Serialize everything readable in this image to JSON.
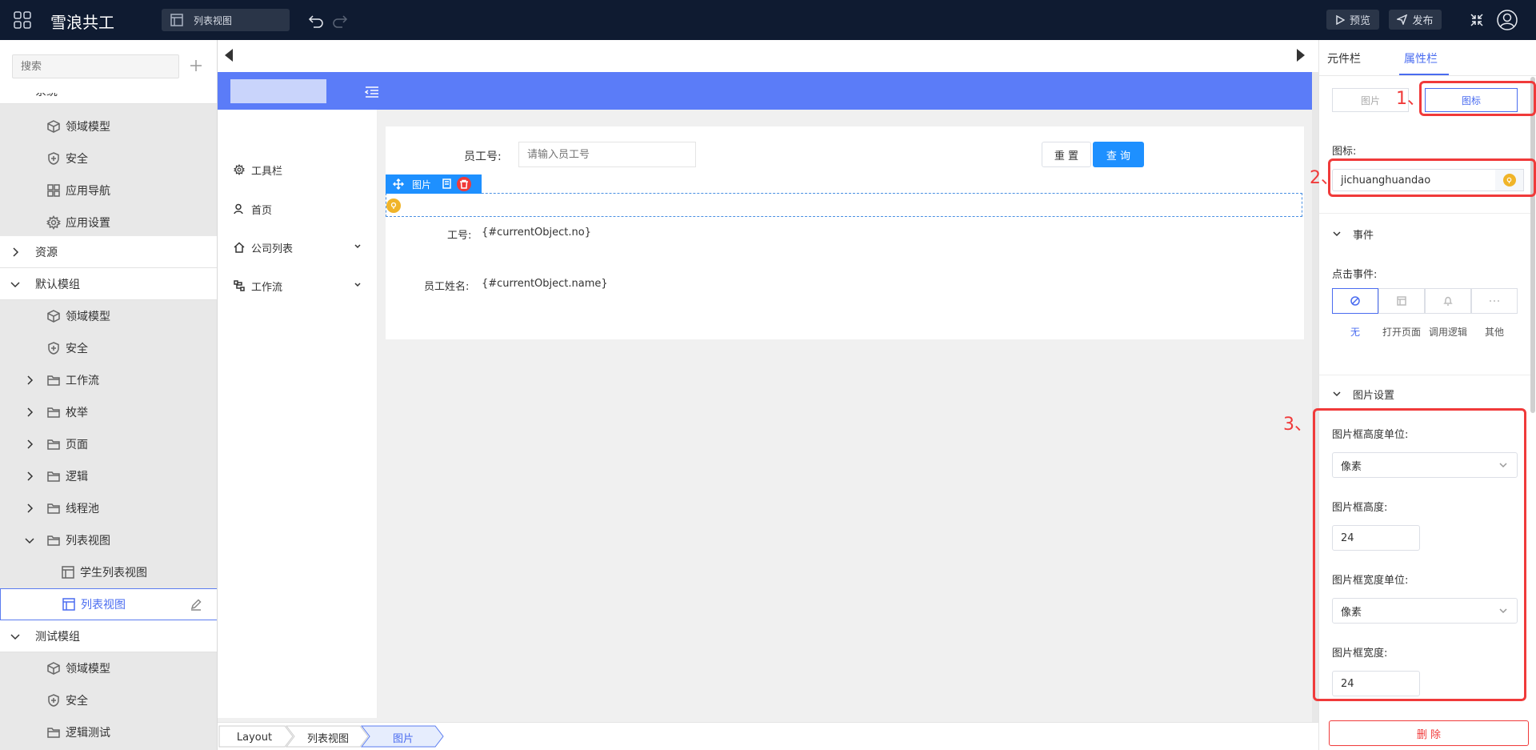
{
  "app": {
    "title": "雪浪共工"
  },
  "toolbar": {
    "view_tab": "列表视图",
    "preview": "预览",
    "publish": "发布"
  },
  "sidebar": {
    "search_placeholder": "搜索",
    "partial_label": "系统",
    "items": {
      "s_domain": "领域模型",
      "s_security": "安全",
      "s_appnav": "应用导航",
      "s_appsettings": "应用设置",
      "resources": "资源",
      "default_module": "默认模组",
      "d_domain": "领域模型",
      "d_security": "安全",
      "d_workflow": "工作流",
      "d_enum": "枚举",
      "d_page": "页面",
      "d_logic": "逻辑",
      "d_threadpool": "线程池",
      "d_listview": "列表视图",
      "d_student_list": "学生列表视图",
      "d_list_active": "列表视图",
      "test_module": "测试模组",
      "t_domain": "领域模型",
      "t_security": "安全",
      "t_logic_test": "逻辑测试"
    }
  },
  "canvas": {
    "nav": {
      "toolbar": "工具栏",
      "home": "首页",
      "company_list": "公司列表",
      "workflow": "工作流"
    },
    "form": {
      "emp_no_label": "员工号:",
      "emp_no_placeholder": "请输入员工号",
      "reset": "重 置",
      "query": "查 询",
      "selected_component": "图片",
      "no_label": "工号:",
      "no_value": "{#currentObject.no}",
      "name_label": "员工姓名:",
      "name_value": "{#currentObject.name}"
    },
    "breadcrumbs": [
      "Layout",
      "列表视图",
      "图片"
    ]
  },
  "right_panel": {
    "tabs": {
      "components": "元件栏",
      "properties": "属性栏"
    },
    "type_toggle": {
      "image": "图片",
      "icon": "图标"
    },
    "icon_label": "图标:",
    "icon_value": "jichuanghuandao",
    "events_section": "事件",
    "click_event_label": "点击事件:",
    "events": {
      "none": "无",
      "open_page": "打开页面",
      "call_logic": "调用逻辑",
      "other": "其他"
    },
    "image_settings_section": "图片设置",
    "height_unit_label": "图片框高度单位:",
    "height_unit": "像素",
    "height_label": "图片框高度:",
    "height_value": "24",
    "width_unit_label": "图片框宽度单位:",
    "width_unit": "像素",
    "width_label": "图片框宽度:",
    "width_value": "24",
    "delete": "删 除"
  },
  "annotations": {
    "a1": "1、",
    "a2": "2、",
    "a3": "3、"
  },
  "colors": {
    "topbar": "#0f1b31",
    "primary": "#1e90ff",
    "header_blue": "#5b7cf8",
    "danger": "#f03a3a",
    "active_text": "#4a6cf0"
  }
}
